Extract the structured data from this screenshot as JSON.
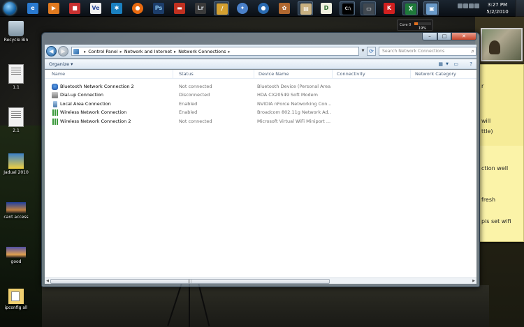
{
  "desktop_icons": [
    {
      "label": "Recycle Bin"
    },
    {
      "label": "1.1"
    },
    {
      "label": "2.1"
    },
    {
      "label": "Jadual 2010"
    },
    {
      "label": "cant access"
    },
    {
      "label": "good"
    },
    {
      "label": "ipconfig all"
    }
  ],
  "taskbar": {
    "time": "3:27 PM",
    "date": "5/2/2010",
    "pinned_icons": [
      "ie-icon",
      "media-player-icon",
      "app-icon",
      "vs-icon",
      "winamp-icon",
      "firefox-icon",
      "photoshop-icon",
      "book-icon",
      "lightroom-icon",
      "utorrent-icon",
      "safari-icon",
      "google-earth-icon",
      "gimp-icon",
      "note-icon",
      "dreamweaver-icon",
      "terminal-icon",
      "monitor-icon",
      "kaspersky-icon",
      "excel-icon",
      "explorer-icon"
    ]
  },
  "gadgets": {
    "cpu_label": "Core 0",
    "cpu_percent": "19%",
    "cpu_level": 0.19,
    "sticky_lines": [
      "r",
      "will",
      "ttle)",
      "ction well",
      "fresh",
      "pis set wifi"
    ]
  },
  "window": {
    "breadcrumb": [
      "Control Panel",
      "Network and Internet",
      "Network Connections"
    ],
    "search_placeholder": "Search Network Connections",
    "organize_label": "Organize ▾",
    "columns": [
      "Name",
      "Status",
      "Device Name",
      "Connectivity",
      "Network Category"
    ],
    "rows": [
      {
        "name": "Bluetooth Network Connection 2",
        "status": "Not connected",
        "device": "Bluetooth Device (Personal Area...",
        "icon": "bluetooth-icon"
      },
      {
        "name": "Dial-up Connection",
        "status": "Disconnected",
        "device": "HDA CX20549 Soft Modem",
        "icon": "modem-icon"
      },
      {
        "name": "Local Area Connection",
        "status": "Enabled",
        "device": "NVIDIA nForce Networking Con...",
        "icon": "lan-icon"
      },
      {
        "name": "Wireless Network Connection",
        "status": "Enabled",
        "device": "Broadcom 802.11g Network Ad...",
        "icon": "wifi-icon"
      },
      {
        "name": "Wireless Network Connection 2",
        "status": "Not connected",
        "device": "Microsoft Virtual WiFi Miniport ...",
        "icon": "wifi-icon"
      }
    ]
  }
}
